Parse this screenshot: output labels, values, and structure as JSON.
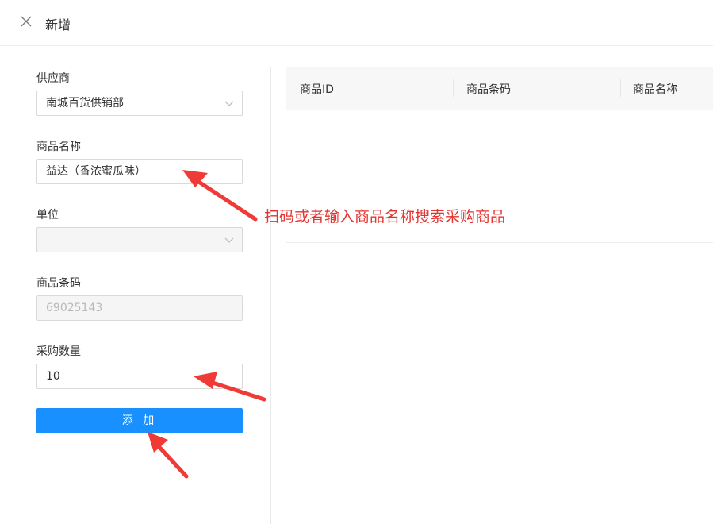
{
  "header": {
    "title": "新增",
    "close_icon": "close-icon"
  },
  "form": {
    "supplier": {
      "label": "供应商",
      "value": "南城百货供销部"
    },
    "product_name": {
      "label": "商品名称",
      "value": "益达（香浓蜜瓜味）"
    },
    "unit": {
      "label": "单位",
      "value": ""
    },
    "barcode": {
      "label": "商品条码",
      "value": "69025143"
    },
    "quantity": {
      "label": "采购数量",
      "value": "10"
    },
    "add_button": "添 加"
  },
  "table": {
    "columns": [
      "商品ID",
      "商品条码",
      "商品名称"
    ]
  },
  "annotation": {
    "text": "扫码或者输入商品名称搜索采购商品",
    "color": "#e5332f"
  },
  "colors": {
    "primary": "#1890ff",
    "annotation": "#e5332f"
  }
}
